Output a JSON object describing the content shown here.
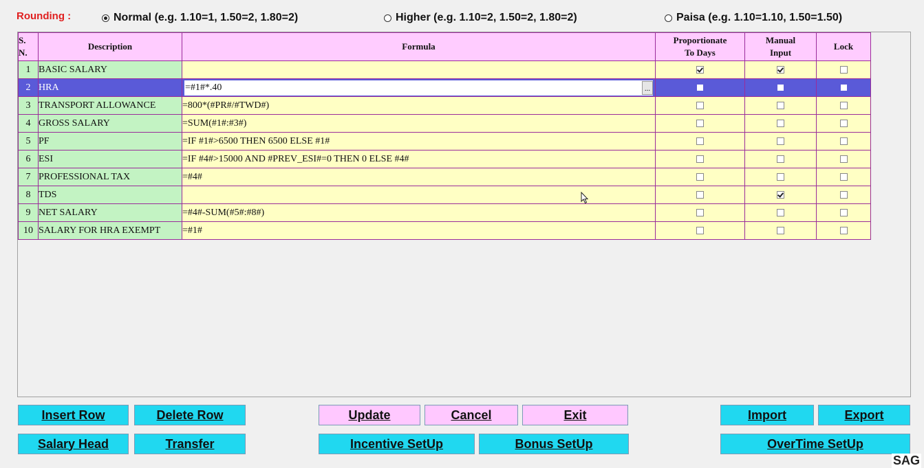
{
  "rounding": {
    "label": "Rounding :",
    "options": [
      {
        "label": "Normal (e.g. 1.10=1, 1.50=2, 1.80=2)",
        "selected": true
      },
      {
        "label": "Higher (e.g. 1.10=2, 1.50=2, 1.80=2)",
        "selected": false
      },
      {
        "label": "Paisa (e.g. 1.10=1.10, 1.50=1.50)",
        "selected": false
      }
    ]
  },
  "grid": {
    "headers": {
      "sn_line1": "S.",
      "sn_line2": "N.",
      "description": "Description",
      "formula": "Formula",
      "proportionate_line1": "Proportionate",
      "proportionate_line2": "To Days",
      "manual_line1": "Manual",
      "manual_line2": "Input",
      "lock": "Lock"
    },
    "rows": [
      {
        "sn": "1",
        "description": "BASIC SALARY",
        "formula": "",
        "proportionate": true,
        "manual": true,
        "lock": false
      },
      {
        "sn": "2",
        "description": "HRA",
        "formula": "=#1#*.40",
        "proportionate": false,
        "manual": false,
        "lock": false
      },
      {
        "sn": "3",
        "description": "TRANSPORT ALLOWANCE",
        "formula": "=800*(#PR#/#TWD#)",
        "proportionate": false,
        "manual": false,
        "lock": false
      },
      {
        "sn": "4",
        "description": "GROSS SALARY",
        "formula": "=SUM(#1#:#3#)",
        "proportionate": false,
        "manual": false,
        "lock": false
      },
      {
        "sn": "5",
        "description": "PF",
        "formula": "=IF #1#>6500 THEN 6500 ELSE #1#",
        "proportionate": false,
        "manual": false,
        "lock": false
      },
      {
        "sn": "6",
        "description": "ESI",
        "formula": "=IF #4#>15000 AND #PREV_ESI#=0 THEN 0 ELSE #4#",
        "proportionate": false,
        "manual": false,
        "lock": false
      },
      {
        "sn": "7",
        "description": "PROFESSIONAL TAX",
        "formula": "=#4#",
        "proportionate": false,
        "manual": false,
        "lock": false
      },
      {
        "sn": "8",
        "description": "TDS",
        "formula": "",
        "proportionate": false,
        "manual": true,
        "lock": false
      },
      {
        "sn": "9",
        "description": "NET SALARY",
        "formula": "=#4#-SUM(#5#:#8#)",
        "proportionate": false,
        "manual": false,
        "lock": false
      },
      {
        "sn": "10",
        "description": "SALARY FOR HRA EXEMPT",
        "formula": "=#1#",
        "proportionate": false,
        "manual": false,
        "lock": false
      }
    ],
    "selected_row": "2",
    "ellipsis": "..."
  },
  "buttons": {
    "insert_row": "Insert Row",
    "delete_row": "Delete Row",
    "update": "Update",
    "cancel": "Cancel",
    "exit": "Exit",
    "import": "Import",
    "export": "Export",
    "salary_head": "Salary Head",
    "transfer": "Transfer",
    "incentive_setup": "Incentive SetUp",
    "bonus_setup": "Bonus SetUp",
    "overtime_setup": "OverTime SetUp"
  },
  "watermark": "SAG",
  "colors": {
    "header_bg": "#ffccff",
    "row_label_bg": "#c3f3c3",
    "formula_bg": "#ffffc4",
    "selected_row_bg": "#5a5ad8",
    "action_button_cyan": "#20d8f0",
    "action_button_pink": "#ffc8ff",
    "rounding_label": "#e02020"
  }
}
